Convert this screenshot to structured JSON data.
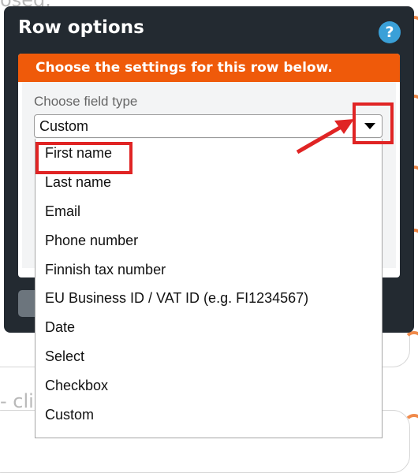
{
  "background": {
    "top_fragment": "osed.",
    "click_fragment": "- clic"
  },
  "dialog": {
    "title": "Row options",
    "help_glyph": "?",
    "panel_header": "Choose the settings for this row below.",
    "field_label": "Choose field type",
    "selected_value": "Custom"
  },
  "dropdown": {
    "options": [
      "First name",
      "Last name",
      "Email",
      "Phone number",
      "Finnish tax number",
      "EU Business ID / VAT ID (e.g. FI1234567)",
      "Date",
      "Select",
      "Checkbox",
      "Custom"
    ]
  },
  "colors": {
    "dialog_bg": "#232a31",
    "header_orange": "#ef5a0a",
    "annotation_red": "#e02424",
    "help_blue": "#3aa0d8"
  }
}
